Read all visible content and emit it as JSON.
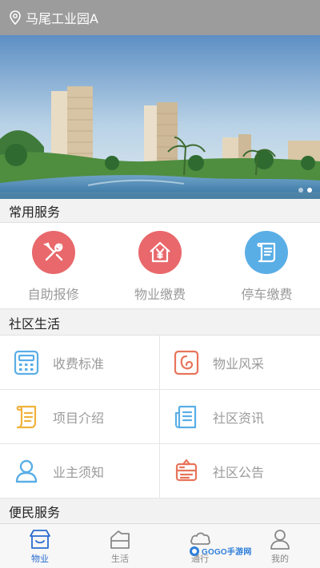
{
  "location": {
    "icon": "location-pin-icon",
    "name": "马尾工业园A"
  },
  "banner": {
    "dots": 2,
    "active_dot": 1
  },
  "sections": {
    "common": "常用服务",
    "community": "社区生活",
    "convenience": "便民服务"
  },
  "common_services": [
    {
      "label": "自助报修",
      "icon": "repair-tools-icon",
      "color": "#e8686b"
    },
    {
      "label": "物业缴费",
      "icon": "house-yen-icon",
      "color": "#e8686b"
    },
    {
      "label": "停车缴费",
      "icon": "receipt-scroll-icon",
      "color": "#5aaee6"
    }
  ],
  "community_items": [
    {
      "label": "收费标准",
      "icon": "calculator-icon",
      "color": "#5aaee6"
    },
    {
      "label": "物业风采",
      "icon": "photo-frame-icon",
      "color": "#e8745a"
    },
    {
      "label": "项目介绍",
      "icon": "scroll-icon",
      "color": "#f0b23c"
    },
    {
      "label": "社区资讯",
      "icon": "news-document-icon",
      "color": "#5aaee6"
    },
    {
      "label": "业主须知",
      "icon": "person-icon",
      "color": "#5aaee6"
    },
    {
      "label": "社区公告",
      "icon": "announcement-icon",
      "color": "#e8745a"
    }
  ],
  "tabs": [
    {
      "label": "物业",
      "icon": "property-house-icon",
      "active": true
    },
    {
      "label": "生活",
      "icon": "life-house-icon",
      "active": false
    },
    {
      "label": "通行",
      "icon": "access-cloud-icon",
      "active": false
    },
    {
      "label": "我的",
      "icon": "profile-person-icon",
      "active": false
    }
  ],
  "watermark": "GOGO手游网",
  "colors": {
    "accent": "#2a6ccf",
    "topbar": "#9c9c9c"
  }
}
